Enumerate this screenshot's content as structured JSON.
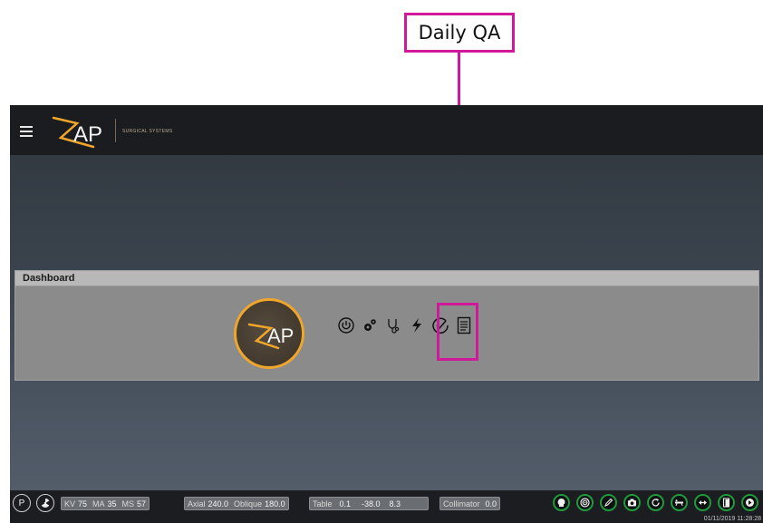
{
  "annotation": {
    "label": "Daily QA"
  },
  "header": {
    "tagline": "SURGICAL SYSTEMS"
  },
  "dashboard": {
    "title": "Dashboard",
    "icons": [
      "power-icon",
      "gears-icon",
      "stethoscope-icon",
      "lightning-icon",
      "check-circle-icon",
      "document-icon"
    ]
  },
  "statusbar": {
    "left_buttons": [
      "P",
      "radiation-icon"
    ],
    "kv": {
      "label": "KV",
      "value": "75"
    },
    "ma": {
      "label": "MA",
      "value": "35"
    },
    "ms": {
      "label": "MS",
      "value": "57"
    },
    "axial": {
      "label": "Axial",
      "value": "240.0"
    },
    "oblique": {
      "label": "Oblique",
      "value": "180.0"
    },
    "table": {
      "label": "Table",
      "values": [
        "0.1",
        "-38.0",
        "8.3"
      ]
    },
    "collimator": {
      "label": "Collimator",
      "value": "0.0"
    },
    "tool_icons": [
      "head-icon",
      "target-icon",
      "pen-icon",
      "camera-icon",
      "refresh-icon",
      "couch-icon",
      "transfer-icon",
      "door-icon",
      "exit-icon"
    ],
    "timestamp": "01/11/2019 11:28:28"
  },
  "colors": {
    "accent": "#f0a62a",
    "annotation": "#d0189a",
    "status_ok": "#1f9a3c"
  }
}
